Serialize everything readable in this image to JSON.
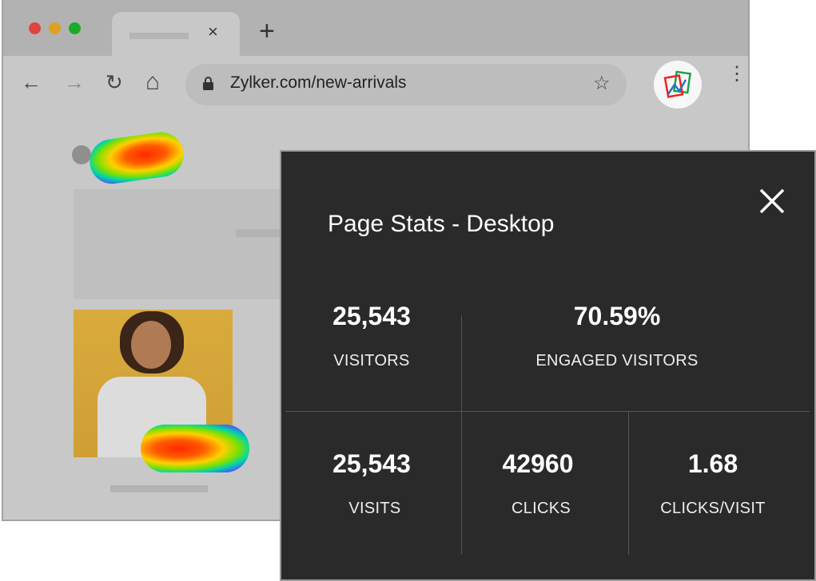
{
  "browser": {
    "url": "Zylker.com/new-arrivals",
    "tab_close": "×",
    "new_tab": "+",
    "back": "←",
    "forward": "→",
    "reload": "↻",
    "home": "⌂",
    "star": "☆",
    "menu": "⋮"
  },
  "colors": {
    "panel_bg": "#2b2a2a",
    "page_bg": "#c8c8c8",
    "image_bg": "#d6a83a"
  },
  "panel": {
    "title": "Page Stats - Desktop",
    "stats": [
      {
        "value": "25,543",
        "label": "VISITORS"
      },
      {
        "value": "70.59%",
        "label": "ENGAGED VISITORS"
      },
      {
        "value": "25,543",
        "label": "VISITS"
      },
      {
        "value": "42960",
        "label": "CLICKS"
      },
      {
        "value": "1.68",
        "label": "CLICKS/VISIT"
      }
    ]
  }
}
